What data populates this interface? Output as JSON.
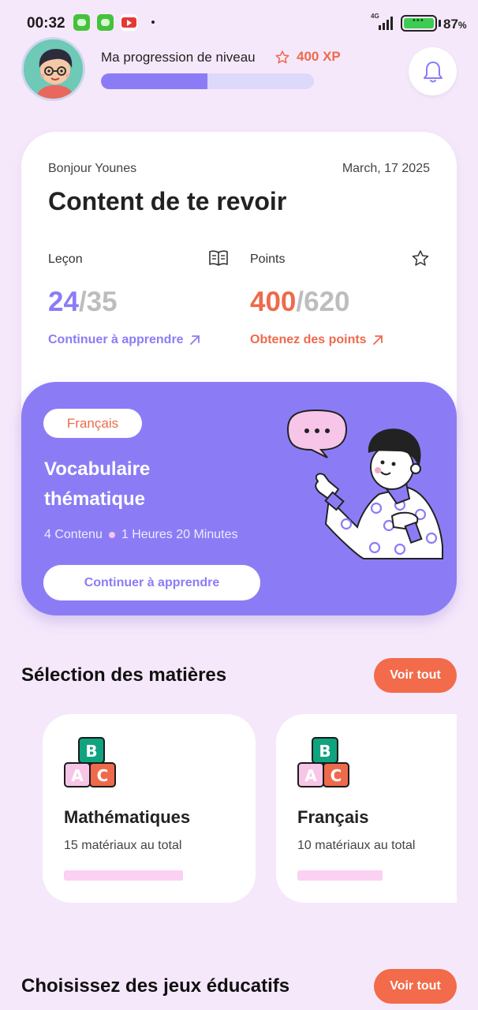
{
  "status_bar": {
    "time": "00:32",
    "network": "4G",
    "battery": "87",
    "battery_suffix": "%"
  },
  "header": {
    "progress_label": "Ma progression de niveau",
    "xp": "400 XP",
    "level_progress_fraction": 0.5,
    "notification_icon": "bell-icon"
  },
  "summary": {
    "greeting": "Bonjour Younes",
    "date": "March, 17 2025",
    "welcome": "Content de te revoir",
    "lesson": {
      "label": "Leçon",
      "icon": "book-icon",
      "current": "24",
      "total": "/35",
      "link": "Continuer à apprendre"
    },
    "points": {
      "label": "Points",
      "icon": "star-icon",
      "current": "400",
      "total": "/620",
      "link": "Obtenez des points"
    }
  },
  "course": {
    "subject": "Français",
    "title": "Vocabulaire thématique",
    "contents": "4 Contenu",
    "duration": "1 Heures 20 Minutes",
    "button": "Continuer à apprendre"
  },
  "subjects_section": {
    "title": "Sélection des matières",
    "see_all": "Voir tout",
    "items": [
      {
        "name": "Mathématiques",
        "count": "15 matériaux au total",
        "progress_fraction": 0.7
      },
      {
        "name": "Français",
        "count": "10 matériaux au total",
        "progress_fraction": 0.5
      }
    ]
  },
  "games_section": {
    "title": "Choisissez des jeux éducatifs",
    "see_all": "Voir tout"
  },
  "colors": {
    "background": "#f6e8fb",
    "primary_purple": "#8b7cf6",
    "accent_orange": "#ee6a4c",
    "button_orange": "#f26b4a"
  }
}
